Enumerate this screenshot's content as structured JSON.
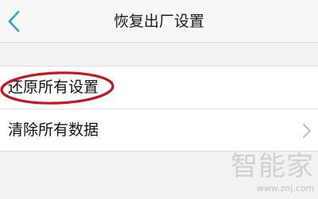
{
  "header": {
    "title": "恢复出厂设置",
    "back_icon": "chevron-left-icon"
  },
  "list": {
    "items": [
      {
        "label": "还原所有设置",
        "highlighted": true
      },
      {
        "label": "清除所有数据",
        "icon": "chevron-right-icon"
      }
    ]
  },
  "annotation": {
    "ellipse_color": "#c8141e"
  },
  "watermark": {
    "logo_text": "智能家",
    "url": "www.znj.com"
  },
  "colors": {
    "accent": "#2aa3e8",
    "background": "#f2f2f2"
  }
}
